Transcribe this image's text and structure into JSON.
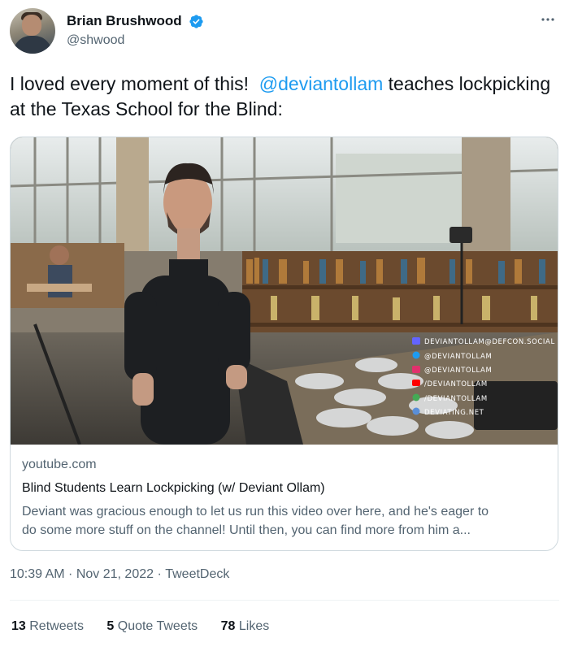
{
  "author": {
    "display_name": "Brian Brushwood",
    "handle": "@shwood"
  },
  "tweet": {
    "text_before": "I loved every moment of this!  ",
    "mention": "@deviantollam",
    "text_after": " teaches lockpicking at the Texas School for the Blind:"
  },
  "card": {
    "domain": "youtube.com",
    "title": "Blind Students Learn Lockpicking (w/ Deviant Ollam)",
    "description_line1": "Deviant was gracious enough to let us run this video over here, and he's eager to",
    "description_line2": "do some more stuff on the channel! Until then, you can find more from him a...",
    "overlay": {
      "mastodon": "DEVIANTOLLAM@DEFCON.SOCIAL",
      "twitter": "@DEVIANTOLLAM",
      "instagram": "@DEVIANTOLLAM",
      "youtube": "/DEVIANTOLLAM",
      "github": "/DEVIANTOLLAM",
      "web": "DEVIATING.NET"
    }
  },
  "meta": {
    "time": "10:39 AM",
    "separator1": " · ",
    "date": "Nov 21, 2022",
    "separator2": " · ",
    "source": "TweetDeck"
  },
  "stats": {
    "retweets_count": "13",
    "retweets_label": " Retweets",
    "quotes_count": "5",
    "quotes_label": " Quote Tweets",
    "likes_count": "78",
    "likes_label": " Likes"
  },
  "colors": {
    "link": "#1d9bf0",
    "secondary_text": "#536471",
    "verified": "#1d9bf0"
  },
  "icons": [
    "verified-badge-icon",
    "more-options-icon",
    "mastodon-icon",
    "twitter-icon",
    "instagram-icon",
    "youtube-icon",
    "github-icon",
    "globe-icon"
  ]
}
